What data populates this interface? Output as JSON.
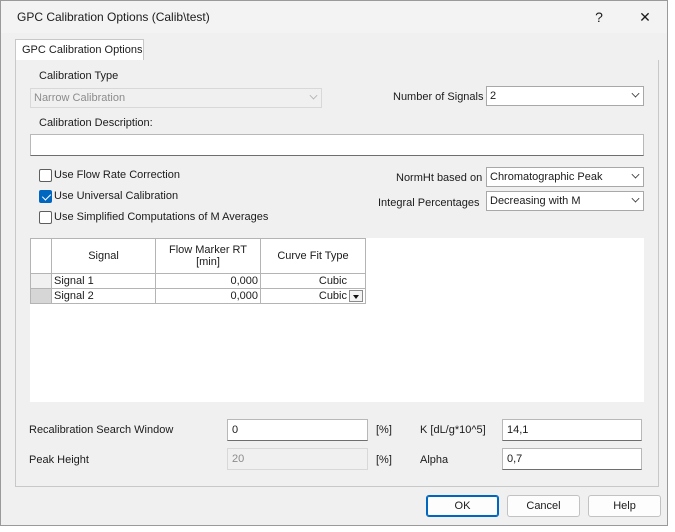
{
  "window": {
    "title": "GPC Calibration Options (Calib\\test)",
    "help_glyph": "?",
    "close_glyph": "✕"
  },
  "tabs": [
    {
      "label": "GPC Calibration Options"
    }
  ],
  "calibration": {
    "type_label": "Calibration Type",
    "type_value": "Narrow Calibration",
    "description_label": "Calibration Description:",
    "description_value": ""
  },
  "signals": {
    "label": "Number of Signals",
    "value": "2"
  },
  "options": {
    "flow_rate": {
      "label": "Use Flow Rate Correction",
      "checked": false
    },
    "universal": {
      "label": "Use Universal Calibration",
      "checked": true
    },
    "simplified": {
      "label": "Use Simplified Computations of M Averages",
      "checked": false
    }
  },
  "normht": {
    "label": "NormHt based on",
    "value": "Chromatographic Peak"
  },
  "integral": {
    "label": "Integral Percentages",
    "value": "Decreasing with M"
  },
  "grid": {
    "columns": [
      "Signal",
      "Flow Marker RT [min]",
      "Curve Fit Type"
    ],
    "rows": [
      {
        "signal": "Signal 1",
        "rt": "0,000",
        "fit": "Cubic"
      },
      {
        "signal": "Signal 2",
        "rt": "0,000",
        "fit": "Cubic"
      }
    ]
  },
  "recal": {
    "label": "Recalibration Search Window",
    "value": "0",
    "unit": "[%]"
  },
  "peak": {
    "label": "Peak Height",
    "value": "20",
    "unit": "[%]"
  },
  "k": {
    "label": "K [dL/g*10^5]",
    "value": "14,1"
  },
  "alpha": {
    "label": "Alpha",
    "value": "0,7"
  },
  "buttons": {
    "ok": "OK",
    "cancel": "Cancel",
    "help": "Help"
  }
}
